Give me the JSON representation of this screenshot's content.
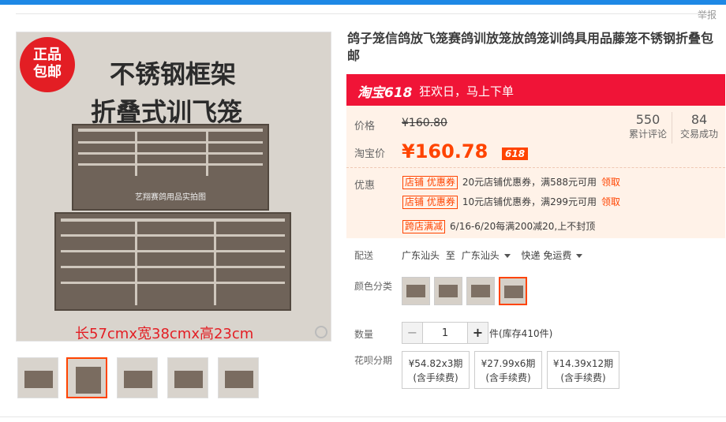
{
  "header": {
    "report_label": "举报"
  },
  "gallery": {
    "badge_line1": "正品",
    "badge_line2": "包邮",
    "headline1": "不锈钢框架",
    "headline2": "折叠式训飞笼",
    "watermark": "艺翔赛鸽用品实拍图",
    "dimensions": "长57cmx宽38cmx高23cm"
  },
  "product": {
    "title": "鸽子笼信鸽放飞笼赛鸽训放笼放鸽笼训鸽具用品藤笼不锈钢折叠包邮"
  },
  "promo": {
    "brand": "淘宝618",
    "slogan": "狂欢日，马上下单"
  },
  "price": {
    "list_label": "价格",
    "list_price": "¥160.80",
    "tb_label": "淘宝价",
    "tb_price": "¥160.78",
    "tag": "618"
  },
  "stats": {
    "reviews_count": "550",
    "reviews_label": "累计评论",
    "sales_count": "84",
    "sales_label": "交易成功"
  },
  "coupons": {
    "label": "优惠",
    "items": [
      {
        "tag": "店铺 优惠券",
        "text": "20元店铺优惠券，满588元可用",
        "claim": "领取"
      },
      {
        "tag": "店铺 优惠券",
        "text": "10元店铺优惠券，满299元可用",
        "claim": "领取"
      },
      {
        "tag": "跨店满减",
        "text": "6/16-6/20每满200减20,上不封顶",
        "claim": ""
      }
    ]
  },
  "delivery": {
    "label": "配送",
    "from": "广东汕头",
    "to_word": "至",
    "to": "广东汕头",
    "method": "快递 免运费"
  },
  "color": {
    "label": "颜色分类"
  },
  "quantity": {
    "label": "数量",
    "minus": "−",
    "value": "1",
    "plus": "+",
    "stock": "件(库存410件)"
  },
  "installment": {
    "label": "花呗分期",
    "options": [
      {
        "amount": "¥54.82x3期",
        "fee": "(含手续费)"
      },
      {
        "amount": "¥27.99x6期",
        "fee": "(含手续费)"
      },
      {
        "amount": "¥14.39x12期",
        "fee": "(含手续费)"
      }
    ]
  }
}
